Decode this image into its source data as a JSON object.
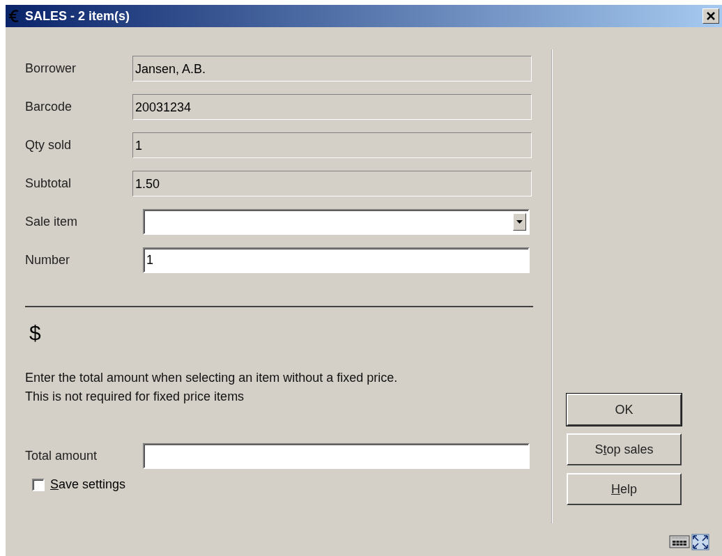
{
  "window": {
    "title": "SALES - 2 item(s)"
  },
  "fields": [
    {
      "label": "Borrower",
      "kind": "readonly",
      "value": "Jansen, A.B."
    },
    {
      "label": "Barcode",
      "kind": "readonly",
      "value": "20031234"
    },
    {
      "label": "Qty sold",
      "kind": "readonly",
      "value": "1"
    },
    {
      "label": "Subtotal",
      "kind": "readonly",
      "value": "1.50"
    },
    {
      "label": "Sale item",
      "kind": "select"
    },
    {
      "label": "Number",
      "kind": "input",
      "value": "1"
    }
  ],
  "currency_symbol": "$",
  "instructions": [
    "Enter the total amount when selecting an item without a fixed price.",
    "This is not required for fixed price items"
  ],
  "total_amount": {
    "label": "Total amount"
  },
  "save_settings": {
    "mnemonic": "S",
    "after": "ave settings",
    "checked": false
  },
  "buttons": [
    {
      "before": "OK",
      "default": true
    },
    {
      "before": "S",
      "mnemonic": "t",
      "after": "op sales",
      "default": false
    },
    {
      "mnemonic": "H",
      "after": "elp",
      "default": false
    }
  ]
}
